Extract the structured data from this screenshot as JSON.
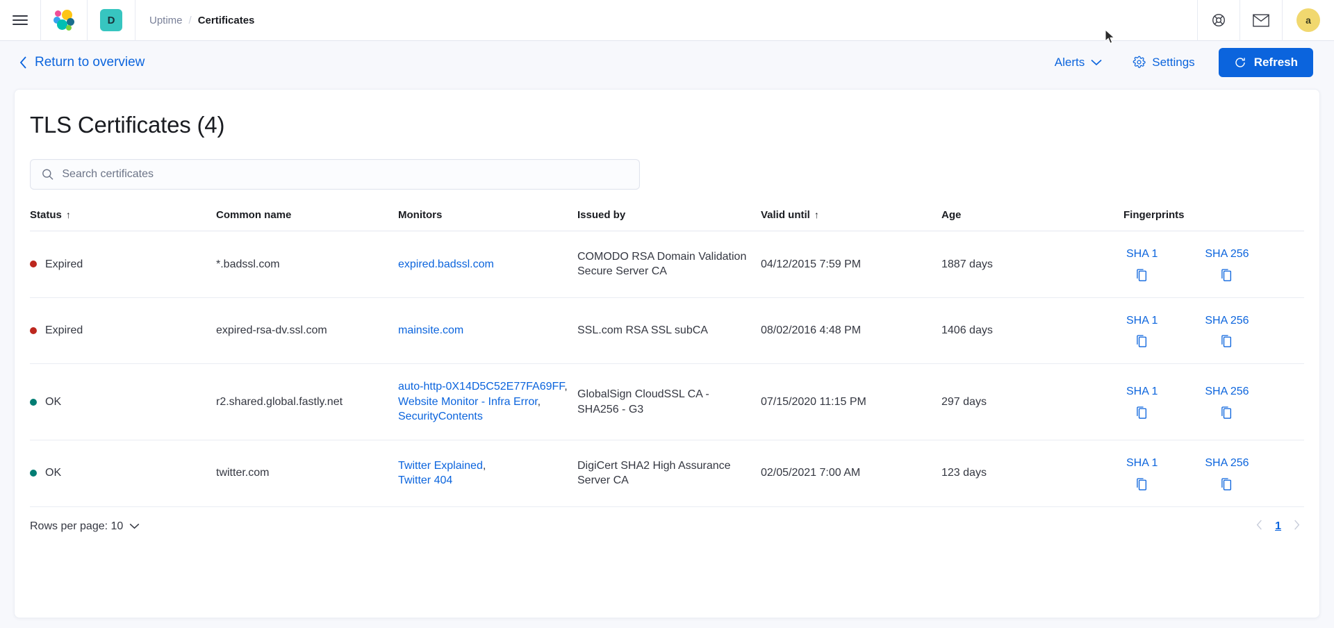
{
  "topbar": {
    "menu_icon": "hamburger-menu-icon",
    "logo_icon": "elastic-logo-icon",
    "space_badge": "D",
    "breadcrumb": {
      "parent": "Uptime",
      "separator": "/",
      "current": "Certificates"
    },
    "help_icon": "lifebuoy-help-icon",
    "mail_icon": "mail-icon",
    "avatar_initial": "a"
  },
  "actionbar": {
    "back_icon": "chevron-left-icon",
    "return_label": "Return to overview",
    "alerts_label": "Alerts",
    "alerts_chevron": "chevron-down-icon",
    "settings_icon": "gear-icon",
    "settings_label": "Settings",
    "refresh_icon": "refresh-icon",
    "refresh_label": "Refresh"
  },
  "panel": {
    "title": "TLS Certificates (4)",
    "search": {
      "icon": "search-icon",
      "placeholder": "Search certificates",
      "value": ""
    },
    "columns": [
      {
        "key": "status",
        "label": "Status",
        "sort": "↑"
      },
      {
        "key": "common_name",
        "label": "Common name",
        "sort": ""
      },
      {
        "key": "monitors",
        "label": "Monitors",
        "sort": ""
      },
      {
        "key": "issued_by",
        "label": "Issued by",
        "sort": ""
      },
      {
        "key": "valid_until",
        "label": "Valid until",
        "sort": "↑"
      },
      {
        "key": "age",
        "label": "Age",
        "sort": ""
      },
      {
        "key": "fingerprints",
        "label": "Fingerprints",
        "sort": ""
      }
    ],
    "rows": [
      {
        "status": "Expired",
        "status_color": "#bd271e",
        "common_name": "*.badssl.com",
        "monitors": [
          "expired.badssl.com"
        ],
        "issued_by": "COMODO RSA Domain Validation Secure Server CA",
        "valid_until": "04/12/2015 7:59 PM",
        "age": "1887 days",
        "fingerprints": [
          "SHA 1",
          "SHA 256"
        ]
      },
      {
        "status": "Expired",
        "status_color": "#bd271e",
        "common_name": "expired-rsa-dv.ssl.com",
        "monitors": [
          "mainsite.com"
        ],
        "issued_by": "SSL.com RSA SSL subCA",
        "valid_until": "08/02/2016 4:48 PM",
        "age": "1406 days",
        "fingerprints": [
          "SHA 1",
          "SHA 256"
        ]
      },
      {
        "status": "OK",
        "status_color": "#017d73",
        "common_name": "r2.shared.global.fastly.net",
        "monitors": [
          "auto-http-0X14D5C52E77FA69FF",
          "Website Monitor - Infra Error",
          "SecurityContents"
        ],
        "issued_by": "GlobalSign CloudSSL CA - SHA256 - G3",
        "valid_until": "07/15/2020 11:15 PM",
        "age": "297 days",
        "fingerprints": [
          "SHA 1",
          "SHA 256"
        ]
      },
      {
        "status": "OK",
        "status_color": "#017d73",
        "common_name": "twitter.com",
        "monitors": [
          "Twitter Explained",
          "Twitter 404"
        ],
        "issued_by": "DigiCert SHA2 High Assurance Server CA",
        "valid_until": "02/05/2021 7:00 AM",
        "age": "123 days",
        "fingerprints": [
          "SHA 1",
          "SHA 256"
        ]
      }
    ],
    "footer": {
      "rows_per_page_label": "Rows per page: 10",
      "rows_chevron": "chevron-down-icon",
      "prev_icon": "chevron-left-icon",
      "current_page": "1",
      "next_icon": "chevron-right-icon"
    }
  },
  "colors": {
    "accent_blue": "#0b64dd",
    "danger_red": "#bd271e",
    "success_green": "#017d73",
    "space_badge_bg": "#37c5c0",
    "avatar_bg": "#f1d86f"
  }
}
